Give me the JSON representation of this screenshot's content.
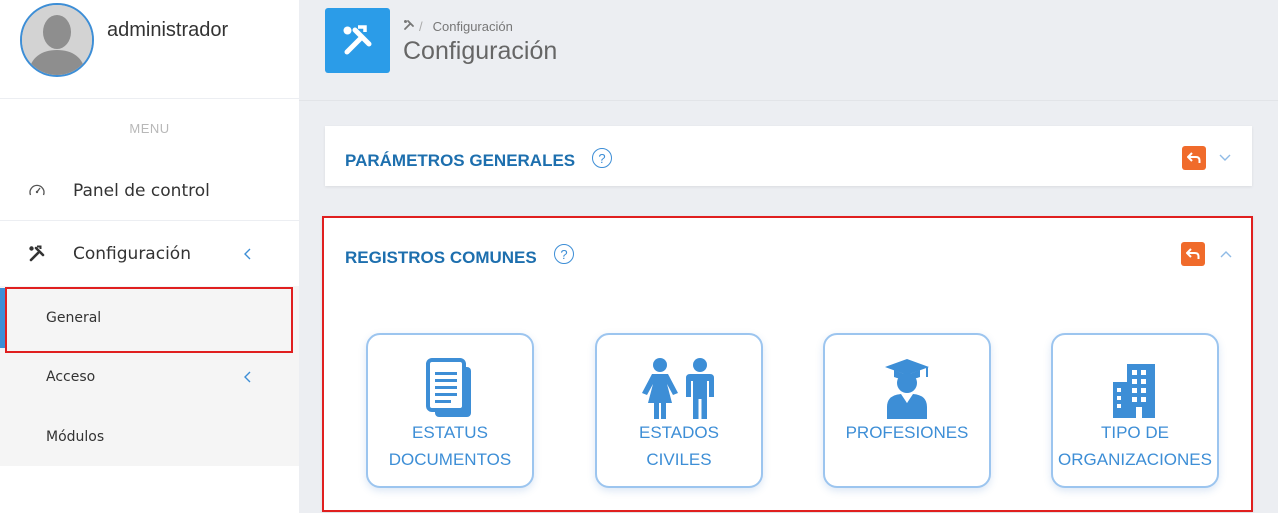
{
  "user": {
    "name": "administrador"
  },
  "sidebar": {
    "menu_title": "MENU",
    "items": [
      {
        "label": "Panel de control",
        "icon": "speedometer-icon"
      },
      {
        "label": "Configuración",
        "icon": "tools-icon"
      }
    ],
    "submenu": [
      {
        "label": "General"
      },
      {
        "label": "Acceso"
      },
      {
        "label": "Módulos"
      }
    ]
  },
  "header": {
    "breadcrumb": "Configuración",
    "breadcrumb_sep": "/",
    "title": "Configuración"
  },
  "sections": [
    {
      "title": "PARÁMETROS GENERALES",
      "help": "?"
    },
    {
      "title": "REGISTROS COMUNES",
      "help": "?",
      "tiles": [
        {
          "line1": "ESTATUS",
          "line2": "DOCUMENTOS",
          "icon": "documents-icon"
        },
        {
          "line1": "ESTADOS",
          "line2": "CIVILES",
          "icon": "people-icon"
        },
        {
          "line1": "PROFESIONES",
          "line2": "",
          "icon": "graduate-icon"
        },
        {
          "line1": "TIPO DE",
          "line2": "ORGANIZACIONES",
          "icon": "building-icon"
        }
      ]
    }
  ],
  "colors": {
    "accent": "#3d8ed6",
    "header_icon_bg": "#2b9ce8",
    "action_orange": "#f06b2b",
    "title_blue": "#1d6fae",
    "highlight_red": "#e01f1f"
  }
}
